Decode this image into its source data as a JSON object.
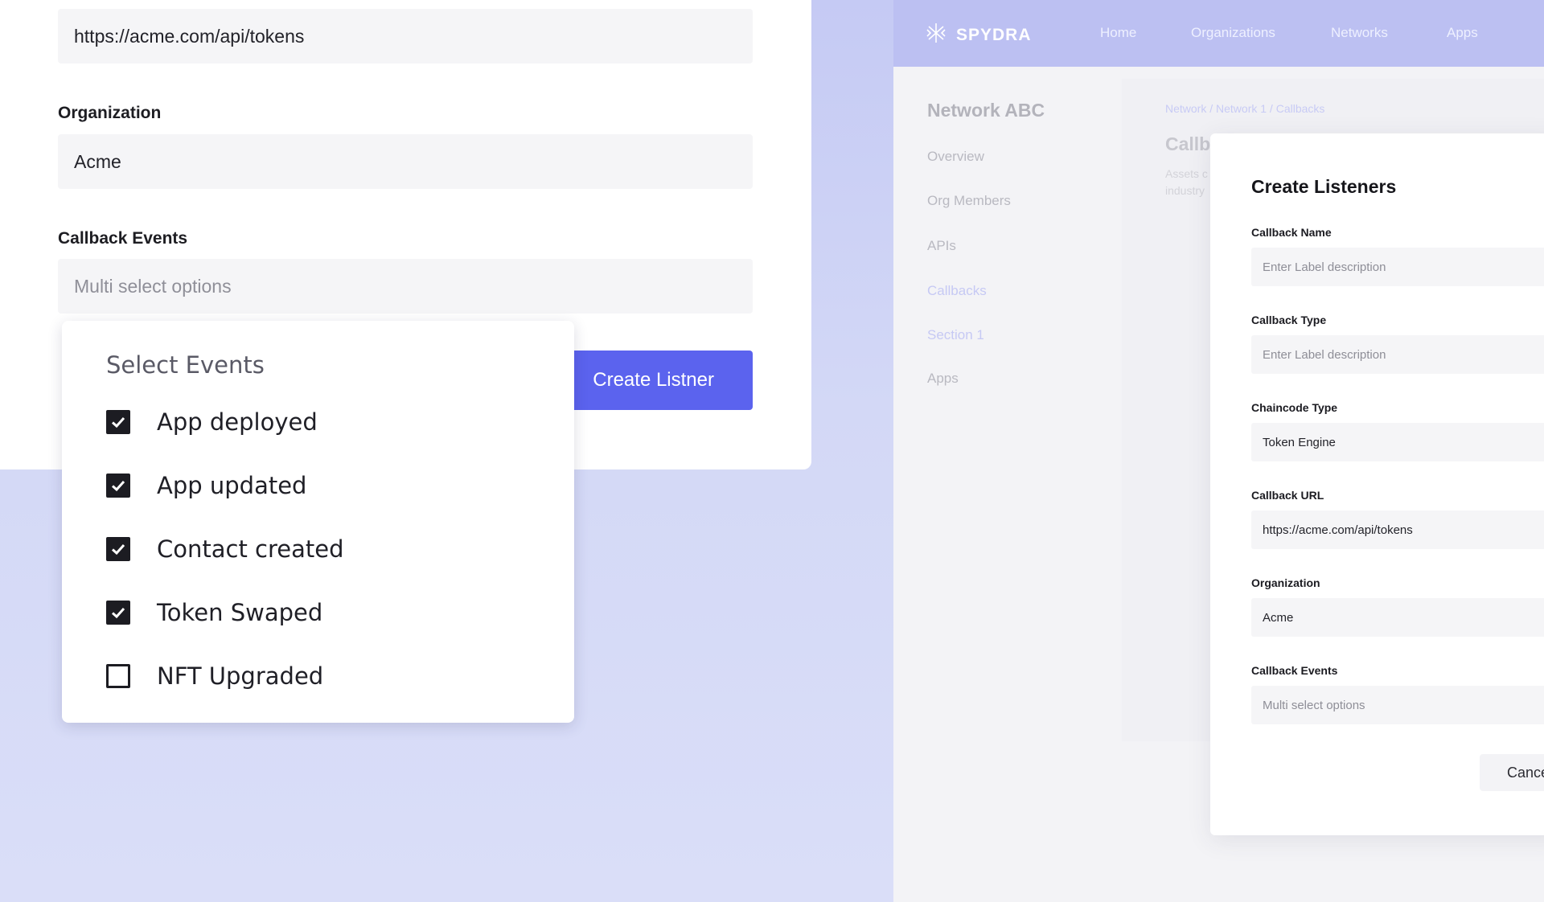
{
  "zoom": {
    "callback_url_value": "https://acme.com/api/tokens",
    "organization_label": "Organization",
    "organization_value": "Acme",
    "callback_events_label": "Callback Events",
    "callback_events_placeholder": "Multi select options",
    "create_button_label": "Create Listner",
    "dropdown": {
      "title": "Select Events",
      "options": [
        {
          "label": "App deployed",
          "checked": true
        },
        {
          "label": "App updated",
          "checked": true
        },
        {
          "label": "Contact created",
          "checked": true
        },
        {
          "label": "Token Swaped",
          "checked": true
        },
        {
          "label": "NFT Upgraded",
          "checked": false
        }
      ]
    }
  },
  "app": {
    "brand": "SPYDRA",
    "nav": [
      "Home",
      "Organizations",
      "Networks",
      "Apps"
    ],
    "sidebar": {
      "title": "Network ABC",
      "items": [
        "Overview",
        "Org Members",
        "APIs",
        "Callbacks",
        "Section 1",
        "Apps"
      ],
      "active": "Callbacks"
    },
    "breadcrumb": "Network / Network 1 / Callbacks",
    "content_title": "Callb",
    "content_subtitle_lines": [
      "Assets c",
      "industry"
    ],
    "modal": {
      "title": "Create Listeners",
      "fields": [
        {
          "label": "Callback Name",
          "value": "Enter Label description",
          "placeholder": true
        },
        {
          "label": "Callback Type",
          "value": "Enter Label description",
          "placeholder": true
        },
        {
          "label": "Chaincode Type",
          "value": "Token Engine",
          "placeholder": false
        },
        {
          "label": "Callback URL",
          "value": "https://acme.com/api/tokens",
          "placeholder": false
        },
        {
          "label": "Organization",
          "value": "Acme",
          "placeholder": false
        },
        {
          "label": "Callback Events",
          "value": "Multi select options",
          "placeholder": true
        }
      ],
      "cancel_label": "Cance"
    }
  },
  "colors": {
    "accent": "#5b63ee",
    "navbar": "#bcc0f2",
    "background": "#d3d8f6"
  }
}
